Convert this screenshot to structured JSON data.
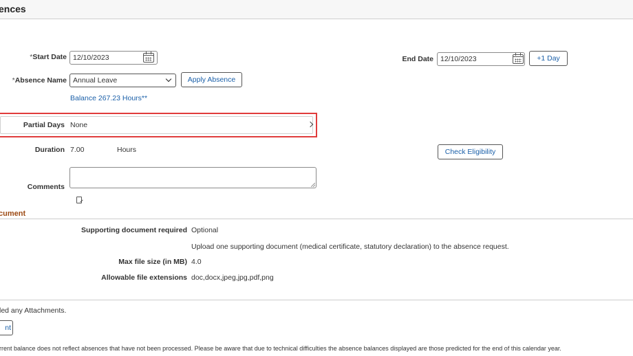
{
  "page": {
    "title": "ences"
  },
  "form": {
    "start_date": {
      "required_mark": "*",
      "label": "Start Date",
      "value": "12/10/2023"
    },
    "end_date": {
      "label": "End Date",
      "value": "12/10/2023"
    },
    "plus_day_label": "+1 Day",
    "absence_name": {
      "required_mark": "*",
      "label": "Absence Name",
      "value": "Annual Leave"
    },
    "apply_absence_label": "Apply Absence",
    "balance_text": "Balance 267.23 Hours**",
    "partial_days": {
      "label": "Partial Days",
      "value": "None"
    },
    "duration": {
      "label": "Duration",
      "value": "7.00",
      "unit": "Hours"
    },
    "check_eligibility_label": "Check Eligibility",
    "comments": {
      "label": "Comments",
      "value": ""
    }
  },
  "document_section": {
    "title": "cument",
    "rows": [
      {
        "label": "Supporting document required",
        "value": "Optional"
      },
      {
        "label": "",
        "value": "Upload one supporting document (medical certificate, statutory declaration) to the absence request."
      },
      {
        "label": "Max file size (in MB)",
        "value": "4.0"
      },
      {
        "label": "Allowable file extensions",
        "value": "doc,docx,jpeg,jpg,pdf,png"
      }
    ]
  },
  "attachments": {
    "status_text": "led any Attachments.",
    "add_button_label": "nt"
  },
  "footer_note": "rrent balance does not reflect absences that have not been processed. Please be aware that due to technical difficulties the absence balances displayed are those predicted for the end of this calendar year.",
  "colors": {
    "link": "#1a5fa8",
    "section_title": "#9c4a14",
    "highlight_border": "#e03c3c"
  },
  "icons": {
    "calendar": "calendar-icon",
    "dropdown": "chevron-down-icon",
    "row_chevron": "chevron-right-icon",
    "spell_check": "spell-check-icon"
  }
}
